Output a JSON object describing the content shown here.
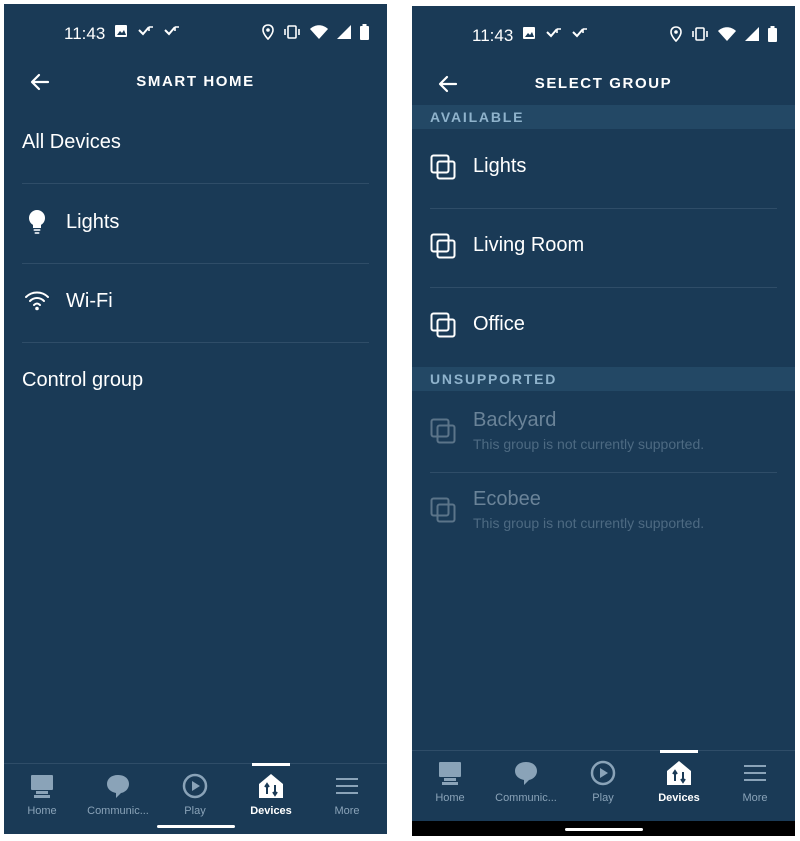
{
  "left": {
    "status": {
      "time": "11:43"
    },
    "title": "SMART HOME",
    "items": [
      {
        "label": "All Devices",
        "icon": "none"
      },
      {
        "label": "Lights",
        "icon": "lightbulb-icon"
      },
      {
        "label": "Wi-Fi",
        "icon": "wifi-icon"
      },
      {
        "label": "Control group",
        "icon": "none"
      }
    ],
    "nav": [
      {
        "label": "Home",
        "icon": "home-icon"
      },
      {
        "label": "Communic...",
        "icon": "chat-bubble-icon"
      },
      {
        "label": "Play",
        "icon": "play-icon"
      },
      {
        "label": "Devices",
        "icon": "devices-icon",
        "active": true
      },
      {
        "label": "More",
        "icon": "menu-icon"
      }
    ]
  },
  "right": {
    "status": {
      "time": "11:43"
    },
    "title": "SELECT GROUP",
    "sections": {
      "available": {
        "header": "AVAILABLE",
        "items": [
          {
            "label": "Lights"
          },
          {
            "label": "Living Room"
          },
          {
            "label": "Office"
          }
        ]
      },
      "unsupported": {
        "header": "UNSUPPORTED",
        "items": [
          {
            "label": "Backyard",
            "sub": "This group is not currently supported."
          },
          {
            "label": "Ecobee",
            "sub": "This group is not currently supported."
          }
        ]
      }
    },
    "nav": [
      {
        "label": "Home",
        "icon": "home-icon"
      },
      {
        "label": "Communic...",
        "icon": "chat-bubble-icon"
      },
      {
        "label": "Play",
        "icon": "play-icon"
      },
      {
        "label": "Devices",
        "icon": "devices-icon",
        "active": true
      },
      {
        "label": "More",
        "icon": "menu-icon"
      }
    ]
  },
  "colors": {
    "background": "#1a3a56",
    "section_header_bg": "#234865",
    "section_header_text": "#8fb3cc",
    "divider": "#2f4d68",
    "disabled_text": "#6a8398"
  }
}
